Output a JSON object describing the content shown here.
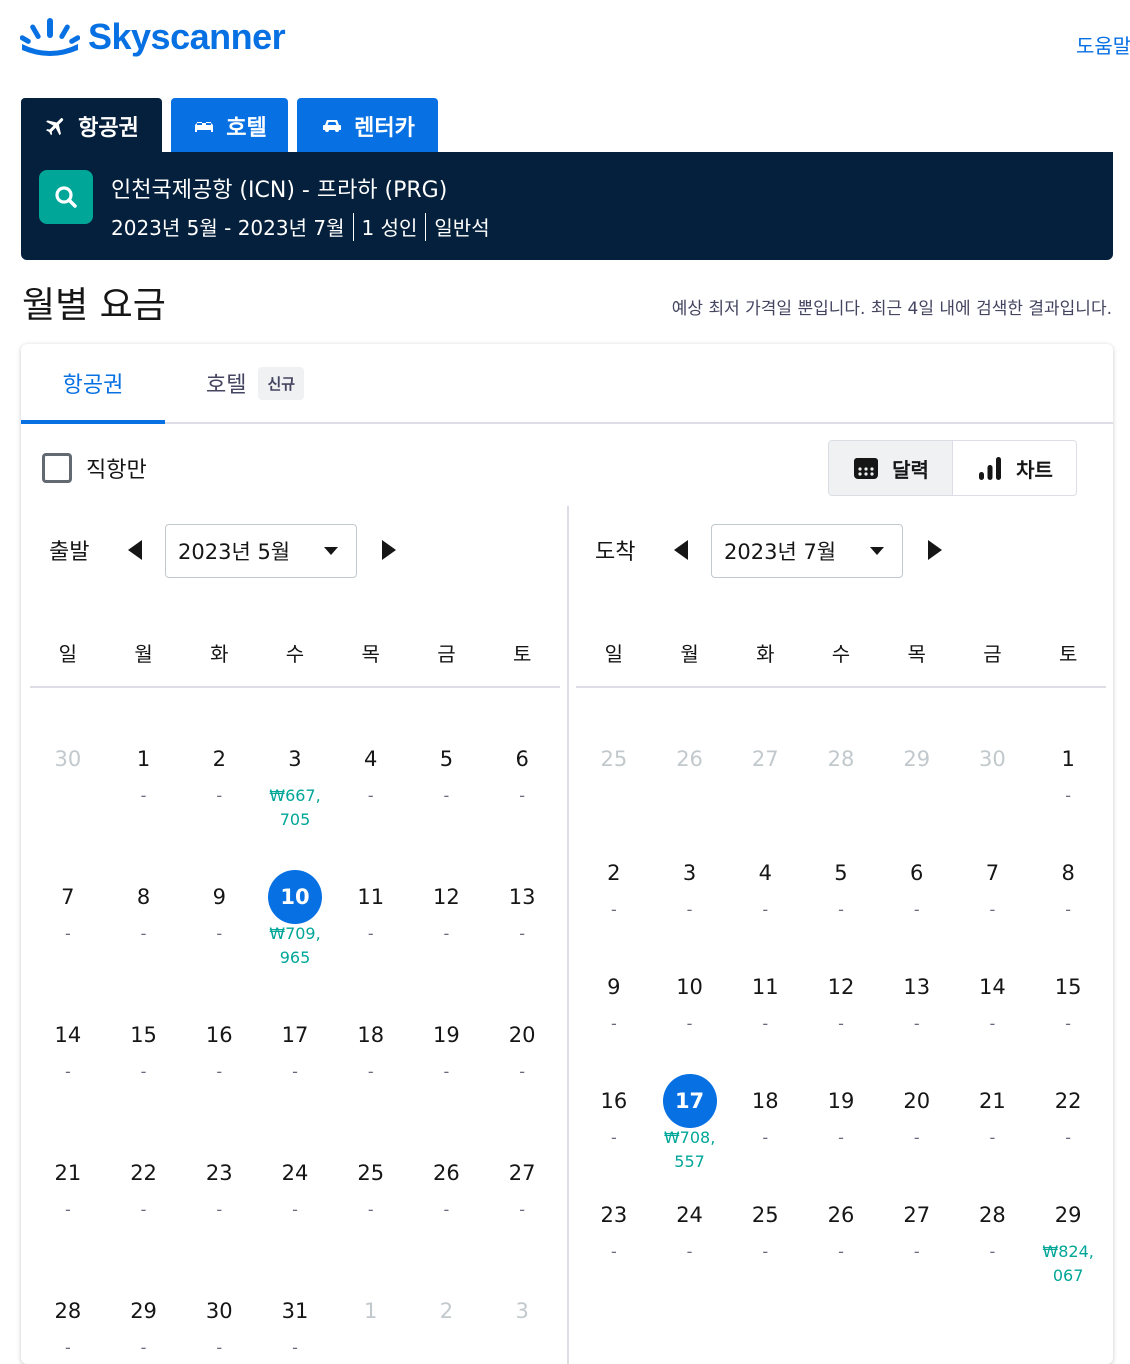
{
  "brand": {
    "name": "Skyscanner",
    "color": "#0770e3"
  },
  "header": {
    "help_label": "도움말"
  },
  "nav_tabs": [
    {
      "label": "항공권",
      "icon": "plane-icon"
    },
    {
      "label": "호텔",
      "icon": "bed-icon"
    },
    {
      "label": "렌터카",
      "icon": "car-icon"
    }
  ],
  "search_summary": {
    "route": "인천국제공항 (ICN) - 프라하 (PRG)",
    "dates": "2023년 5월 - 2023년 7월",
    "travellers": "1 성인",
    "cabin": "일반석"
  },
  "page": {
    "title": "월별 요금",
    "note": "예상 최저 가격일 뿐입니다. 최근 4일 내에 검색한 결과입니다."
  },
  "card_tabs": {
    "flights": "항공권",
    "hotels": "호텔",
    "new_badge": "신규"
  },
  "filters": {
    "direct_only": "직항만",
    "direct_only_checked": false
  },
  "view_toggle": {
    "calendar": "달력",
    "chart": "차트",
    "active": "calendar"
  },
  "weekdays": [
    "일",
    "월",
    "화",
    "수",
    "목",
    "금",
    "토"
  ],
  "departure": {
    "label": "출발",
    "month": "2023년 5월",
    "days": [
      {
        "d": "30",
        "out": true
      },
      {
        "d": "1",
        "p": "-"
      },
      {
        "d": "2",
        "p": "-"
      },
      {
        "d": "3",
        "p": "₩667,\n705",
        "price": true
      },
      {
        "d": "4",
        "p": "-"
      },
      {
        "d": "5",
        "p": "-"
      },
      {
        "d": "6",
        "p": "-"
      },
      {
        "d": "7",
        "p": "-"
      },
      {
        "d": "8",
        "p": "-"
      },
      {
        "d": "9",
        "p": "-"
      },
      {
        "d": "10",
        "p": "₩709,\n965",
        "price": true,
        "sel": true
      },
      {
        "d": "11",
        "p": "-"
      },
      {
        "d": "12",
        "p": "-"
      },
      {
        "d": "13",
        "p": "-"
      },
      {
        "d": "14",
        "p": "-"
      },
      {
        "d": "15",
        "p": "-"
      },
      {
        "d": "16",
        "p": "-"
      },
      {
        "d": "17",
        "p": "-"
      },
      {
        "d": "18",
        "p": "-"
      },
      {
        "d": "19",
        "p": "-"
      },
      {
        "d": "20",
        "p": "-"
      },
      {
        "d": "21",
        "p": "-"
      },
      {
        "d": "22",
        "p": "-"
      },
      {
        "d": "23",
        "p": "-"
      },
      {
        "d": "24",
        "p": "-"
      },
      {
        "d": "25",
        "p": "-"
      },
      {
        "d": "26",
        "p": "-"
      },
      {
        "d": "27",
        "p": "-"
      },
      {
        "d": "28",
        "p": "-"
      },
      {
        "d": "29",
        "p": "-"
      },
      {
        "d": "30",
        "p": "-"
      },
      {
        "d": "31",
        "p": "-"
      },
      {
        "d": "1",
        "out": true
      },
      {
        "d": "2",
        "out": true
      },
      {
        "d": "3",
        "out": true
      }
    ]
  },
  "arrival": {
    "label": "도착",
    "month": "2023년 7월",
    "days": [
      {
        "d": "25",
        "out": true
      },
      {
        "d": "26",
        "out": true
      },
      {
        "d": "27",
        "out": true
      },
      {
        "d": "28",
        "out": true
      },
      {
        "d": "29",
        "out": true
      },
      {
        "d": "30",
        "out": true
      },
      {
        "d": "1",
        "p": "-"
      },
      {
        "d": "2",
        "p": "-"
      },
      {
        "d": "3",
        "p": "-"
      },
      {
        "d": "4",
        "p": "-"
      },
      {
        "d": "5",
        "p": "-"
      },
      {
        "d": "6",
        "p": "-"
      },
      {
        "d": "7",
        "p": "-"
      },
      {
        "d": "8",
        "p": "-"
      },
      {
        "d": "9",
        "p": "-"
      },
      {
        "d": "10",
        "p": "-"
      },
      {
        "d": "11",
        "p": "-"
      },
      {
        "d": "12",
        "p": "-"
      },
      {
        "d": "13",
        "p": "-"
      },
      {
        "d": "14",
        "p": "-"
      },
      {
        "d": "15",
        "p": "-"
      },
      {
        "d": "16",
        "p": "-"
      },
      {
        "d": "17",
        "p": "₩708,\n557",
        "price": true,
        "sel": true
      },
      {
        "d": "18",
        "p": "-"
      },
      {
        "d": "19",
        "p": "-"
      },
      {
        "d": "20",
        "p": "-"
      },
      {
        "d": "21",
        "p": "-"
      },
      {
        "d": "22",
        "p": "-"
      },
      {
        "d": "23",
        "p": "-"
      },
      {
        "d": "24",
        "p": "-"
      },
      {
        "d": "25",
        "p": "-"
      },
      {
        "d": "26",
        "p": "-"
      },
      {
        "d": "27",
        "p": "-"
      },
      {
        "d": "28",
        "p": "-"
      },
      {
        "d": "29",
        "p": "₩824,\n067",
        "price": true
      }
    ]
  },
  "colors": {
    "navy": "#05203c",
    "blue": "#0770e3",
    "teal": "#00a698"
  }
}
